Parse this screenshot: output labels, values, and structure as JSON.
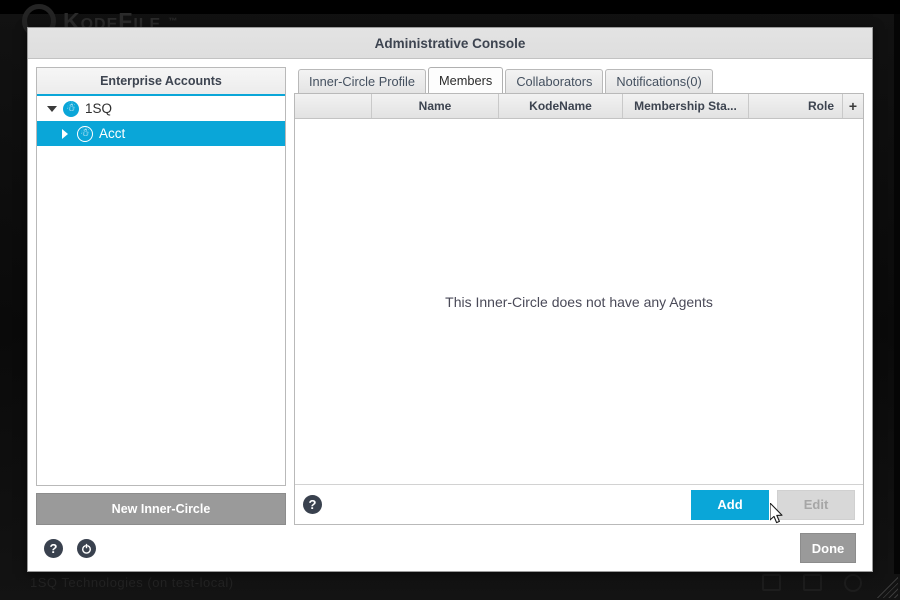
{
  "desktop": {
    "logo_text": "KodeFile",
    "logo_tm": "™",
    "logo_ring_icon": "ring-logo-icon",
    "status_text": "1SQ Technologies (on test-local)",
    "tray_icons": [
      "window-icon",
      "window-icon",
      "circle-icon"
    ],
    "resize_grip": "resize-grip-icon"
  },
  "dialog": {
    "title": "Administrative Console"
  },
  "sidebar": {
    "header": "Enterprise Accounts",
    "tree": [
      {
        "label": "1SQ",
        "expanded": true,
        "selected": false,
        "level": 1,
        "icon": "group-users-icon"
      },
      {
        "label": "Acct",
        "expanded": false,
        "selected": true,
        "level": 2,
        "icon": "group-users-outline-icon"
      }
    ],
    "new_circle_label": "New Inner-Circle"
  },
  "tabs": [
    {
      "label": "Inner-Circle Profile",
      "active": false
    },
    {
      "label": "Members",
      "active": true
    },
    {
      "label": "Collaborators",
      "active": false
    },
    {
      "label": "Notifications(0)",
      "active": false
    }
  ],
  "members_table": {
    "columns": [
      "",
      "Name",
      "KodeName",
      "Membership Sta...",
      "Role"
    ],
    "add_column_label": "+",
    "rows": [],
    "empty_message": "This Inner-Circle does not have any Agents"
  },
  "panel_actions": {
    "help_icon_label": "?",
    "add_label": "Add",
    "edit_label": "Edit",
    "add_enabled": true,
    "edit_enabled": false
  },
  "footer": {
    "help_icon_label": "?",
    "power_icon_label": "power-icon",
    "done_label": "Done"
  },
  "colors": {
    "accent": "#0aa6d8",
    "selection": "#0aa6d8",
    "disabled_button": "#9a9a9a",
    "title_text": "#3d4450",
    "empty_text": "#4a4a58"
  }
}
